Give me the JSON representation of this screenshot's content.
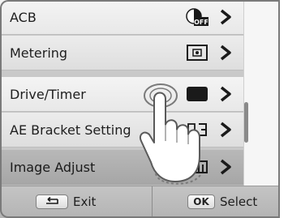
{
  "menu": {
    "items": [
      {
        "label": "ACB",
        "icon": "acb-off-icon",
        "selected": false
      },
      {
        "label": "Metering",
        "icon": "metering-icon",
        "selected": false
      },
      {
        "label": "Drive/Timer",
        "icon": "single-shot-icon",
        "selected": false
      },
      {
        "label": "AE Bracket Setting",
        "icon": "ae-bracket-icon",
        "selected": false
      },
      {
        "label": "Image Adjust",
        "icon": "image-adjust-icon",
        "selected": true
      }
    ],
    "acb_icon_text": "OFF",
    "chevron_icon": "chevron-right-icon"
  },
  "footer": {
    "exit_key_icon": "back-arrow-icon",
    "exit_label": "Exit",
    "select_key": "OK",
    "select_label": "Select"
  },
  "colors": {
    "selected_row": "#b0b0b0",
    "row": "#eeeeee",
    "footer": "#bcbcbc"
  }
}
